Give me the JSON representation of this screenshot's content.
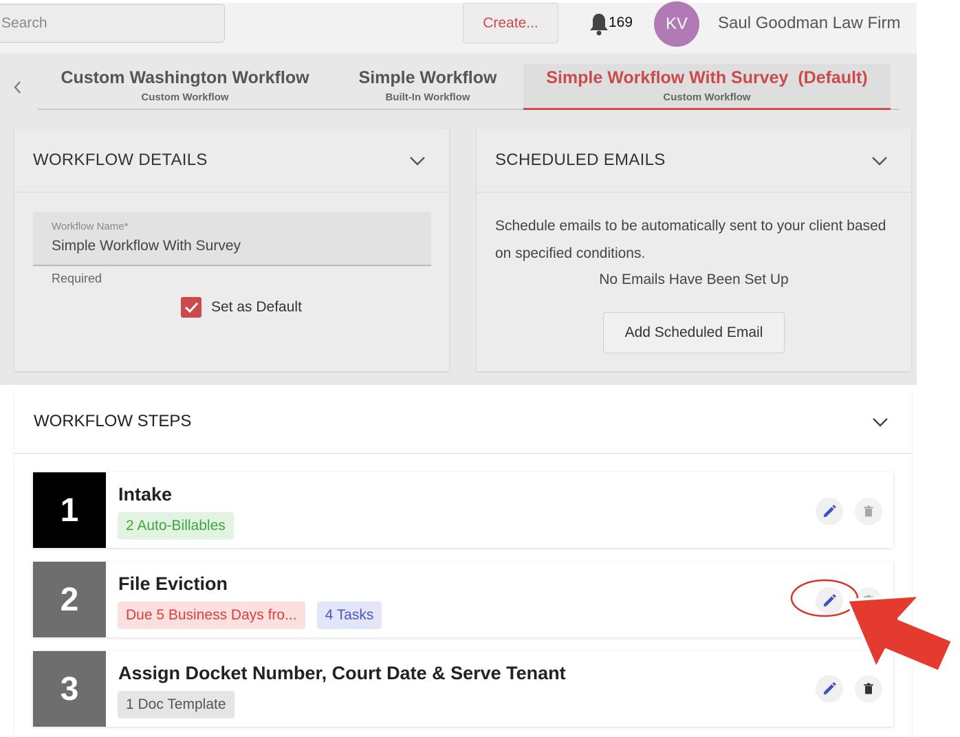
{
  "header": {
    "search_placeholder": "Search",
    "create_label": "Create...",
    "notification_count": "169",
    "avatar_initials": "KV",
    "firm_name": "Saul Goodman Law Firm"
  },
  "tabs": [
    {
      "title": "Custom Washington Workflow",
      "subtitle": "Custom Workflow",
      "active": false
    },
    {
      "title": "Simple Workflow",
      "subtitle": "Built-In Workflow",
      "active": false
    },
    {
      "title": "Simple Workflow With Survey  (Default)",
      "subtitle": "Custom Workflow",
      "active": true
    }
  ],
  "workflow_details": {
    "heading": "WORKFLOW DETAILS",
    "field_label": "Workflow Name*",
    "field_value": "Simple Workflow With Survey",
    "helper_text": "Required",
    "default_checked": true,
    "default_label": "Set as Default"
  },
  "scheduled_emails": {
    "heading": "SCHEDULED EMAILS",
    "description": "Schedule emails to be automatically sent to your client based on specified conditions.",
    "empty_text": "No Emails Have Been Set Up",
    "add_button": "Add Scheduled Email"
  },
  "workflow_steps": {
    "heading": "WORKFLOW STEPS",
    "steps": [
      {
        "number": "1",
        "title": "Intake",
        "chips": [
          {
            "text": "2 Auto-Billables",
            "color": "green"
          }
        ]
      },
      {
        "number": "2",
        "title": "File Eviction",
        "chips": [
          {
            "text": "Due 5 Business Days fro...",
            "color": "red"
          },
          {
            "text": "4 Tasks",
            "color": "blue"
          }
        ]
      },
      {
        "number": "3",
        "title": "Assign Docket Number, Court Date & Serve Tenant",
        "chips": [
          {
            "text": "1 Doc Template",
            "color": "gray"
          }
        ]
      }
    ]
  },
  "colors": {
    "accent": "#c94b4b",
    "avatar": "#b07ab4",
    "step1": "#000000",
    "step_other": "#6e6e6e",
    "edit_icon": "#3d4fc4",
    "annotation": "#e53a2f"
  }
}
